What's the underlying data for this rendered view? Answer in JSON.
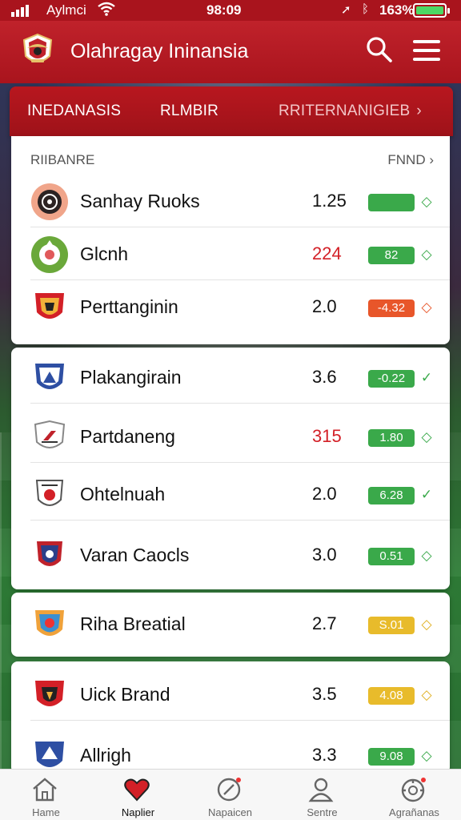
{
  "status_bar": {
    "carrier": "Aylmci",
    "time": "98:09",
    "battery_pct": "163%"
  },
  "app_bar": {
    "title": "Olahragay Ininansia",
    "logo_icon": "garuda-emblem-icon",
    "search_icon": "search-icon",
    "menu_icon": "hamburger-menu-icon"
  },
  "tabs": [
    {
      "label": "INEDANASIS"
    },
    {
      "label": "RLMBIR"
    },
    {
      "label": "RRITERNANIGIEB",
      "chevron": "›"
    }
  ],
  "section": {
    "left_label": "RIIBANRE",
    "right_label": "FNND",
    "right_chevron": "›"
  },
  "groups": [
    {
      "rows": [
        {
          "name": "Sanhay Ruoks",
          "value": "1.25",
          "value_color": "black",
          "pill": "",
          "pill_color": "green",
          "indicator": "◇",
          "icon": "team-crest-dark-circle-icon"
        },
        {
          "name": "Glcnh",
          "value": "224",
          "value_color": "red",
          "pill": "82",
          "pill_color": "green",
          "indicator": "◇",
          "icon": "team-crest-green-circle-icon"
        },
        {
          "name": "Perttanginin",
          "value": "2.0",
          "value_color": "black",
          "pill": "-4.32",
          "pill_color": "orange",
          "indicator": "◇",
          "icon": "team-crest-red-shield-icon"
        }
      ]
    },
    {
      "rows": [
        {
          "name": "Plakangirain",
          "value": "3.6",
          "value_color": "black",
          "pill": "-0.22",
          "pill_color": "green",
          "indicator": "✓",
          "icon": "team-crest-blue-shield-icon"
        },
        {
          "name": "Partdaneng",
          "value": "315",
          "value_color": "red",
          "pill": "1.80",
          "pill_color": "green",
          "indicator": "◇",
          "icon": "team-crest-white-shield-icon"
        },
        {
          "name": "Ohtelnuah",
          "value": "2.0",
          "value_color": "black",
          "pill": "6.28",
          "pill_color": "green",
          "indicator": "✓",
          "icon": "team-crest-white-red-shield-icon"
        },
        {
          "name": "Varan Caocls",
          "value": "3.0",
          "value_color": "black",
          "pill": "0.51",
          "pill_color": "green",
          "indicator": "◇",
          "icon": "team-crest-navy-red-shield-icon"
        }
      ]
    },
    {
      "rows": [
        {
          "name": "Riha Breatial",
          "value": "2.7",
          "value_color": "black",
          "pill": "S.01",
          "pill_color": "yellow",
          "indicator": "◇",
          "icon": "team-crest-multicolor-shield-icon"
        }
      ]
    },
    {
      "rows": [
        {
          "name": "Uick Brand",
          "value": "3.5",
          "value_color": "black",
          "pill": "4.08",
          "pill_color": "yellow",
          "indicator": "◇",
          "icon": "team-crest-red-black-shield-icon"
        },
        {
          "name": "Allrigh",
          "value": "3.3",
          "value_color": "black",
          "pill": "9.08",
          "pill_color": "green",
          "indicator": "◇",
          "icon": "team-crest-blue-shield-icon"
        }
      ]
    }
  ],
  "bottom_nav": [
    {
      "label": "Hame",
      "icon": "home-icon"
    },
    {
      "label": "Naplier",
      "icon": "heart-icon"
    },
    {
      "label": "Napaicen",
      "icon": "compass-icon"
    },
    {
      "label": "Sentre",
      "icon": "person-icon"
    },
    {
      "label": "Agrañanas",
      "icon": "settings-gauge-icon"
    }
  ],
  "colors": {
    "brand_red": "#a9141d",
    "pill_green": "#3aa94a",
    "pill_orange": "#e8562a",
    "pill_yellow": "#e8bb2b",
    "value_red": "#d32027"
  }
}
